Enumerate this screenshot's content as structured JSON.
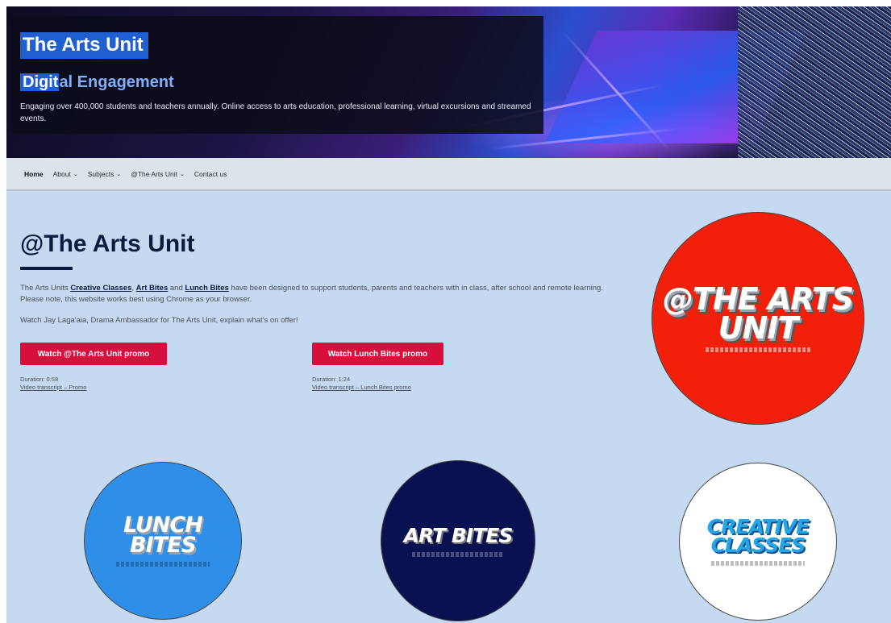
{
  "hero": {
    "title": "The Arts Unit",
    "subtitle_highlight": "Digit",
    "subtitle_rest": "al Engagement",
    "description": "Engaging over 400,000 students and teachers annually. Online access to arts education, professional learning, virtual excursions and streamed events."
  },
  "nav": {
    "items": [
      {
        "label": "Home",
        "active": true,
        "dropdown": false
      },
      {
        "label": "About",
        "active": false,
        "dropdown": true
      },
      {
        "label": "Subjects",
        "active": false,
        "dropdown": true
      },
      {
        "label": "@The Arts Unit",
        "active": false,
        "dropdown": true
      },
      {
        "label": "Contact us",
        "active": false,
        "dropdown": false
      }
    ],
    "chevron": "⌄"
  },
  "main": {
    "title": "@The Arts Unit",
    "intro_prefix": "The Arts Units ",
    "link_creative": "Creative Classes",
    "link_artbites": "Art Bites",
    "intro_and": " and ",
    "link_lunch": "Lunch Bites",
    "intro_suffix": "  have been designed to support students, parents and teachers with in class, after school and remote learning. Please note, this website works best using Chrome as your browser.",
    "watch_text": "Watch Jay Laga'aia, Drama Ambassador for The Arts Unit, explain what's on offer!",
    "promo_button": "Watch @The Arts Unit promo",
    "lunch_button": "Watch Lunch Bites promo",
    "promo_duration": "Duration: 0:58",
    "promo_transcript": "Video transcript – Promo",
    "lunch_duration": "Duration: 1:24",
    "lunch_transcript": "Video transcript – Lunch Bites promo"
  },
  "logos": {
    "main": {
      "line1": "@THE ARTS",
      "line2": "UNIT"
    },
    "lunch": {
      "line1": "LUNCH",
      "line2": "BITES"
    },
    "art": {
      "line1": "ART BITES"
    },
    "creative": {
      "line1": "CREATIVE",
      "line2": "CLASSES"
    }
  },
  "colors": {
    "accent_red": "#d60f3d",
    "page_bg": "#c5daf0",
    "navy": "#0c1a40",
    "highlight_blue": "#1f5fd0"
  }
}
